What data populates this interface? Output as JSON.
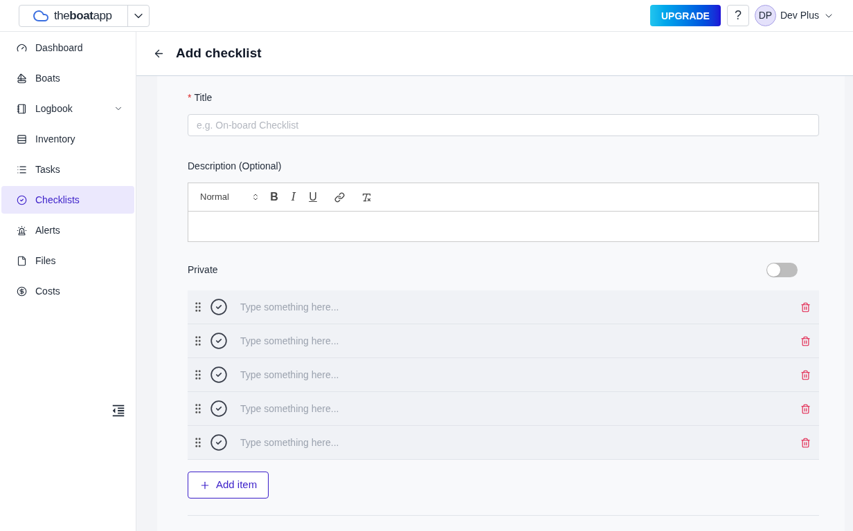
{
  "header": {
    "logo": "the**boat**app",
    "upgrade": "UPGRADE",
    "help": "?",
    "user": {
      "initials": "DP",
      "name": "Dev Plus"
    }
  },
  "sidebar": {
    "items": [
      {
        "label": "Dashboard",
        "selected": false,
        "kind": "link"
      },
      {
        "label": "Boats",
        "selected": false,
        "kind": "link"
      },
      {
        "label": "Logbook",
        "selected": false,
        "kind": "group",
        "expanded": false
      },
      {
        "label": "Inventory",
        "selected": false,
        "kind": "link"
      },
      {
        "label": "Tasks",
        "selected": false,
        "kind": "link"
      },
      {
        "label": "Checklists",
        "selected": true,
        "kind": "link"
      },
      {
        "label": "Alerts",
        "selected": false,
        "kind": "link"
      },
      {
        "label": "Files",
        "selected": false,
        "kind": "link"
      },
      {
        "label": "Costs",
        "selected": false,
        "kind": "link"
      }
    ]
  },
  "page": {
    "title": "Add checklist"
  },
  "form": {
    "title_field": {
      "label": "Title",
      "required_mark": "*",
      "placeholder": "e.g. On-board Checklist"
    },
    "description": {
      "label": "Description (Optional)",
      "format": "Normal",
      "buttons": [
        "B",
        "I",
        "U"
      ]
    },
    "private": {
      "label": "Private",
      "on": false
    },
    "items": [
      {
        "placeholder": "Type something here..."
      },
      {
        "placeholder": "Type something here..."
      },
      {
        "placeholder": "Type something here..."
      },
      {
        "placeholder": "Type something here..."
      },
      {
        "placeholder": "Type something here..."
      }
    ],
    "add_item": "Add item"
  }
}
